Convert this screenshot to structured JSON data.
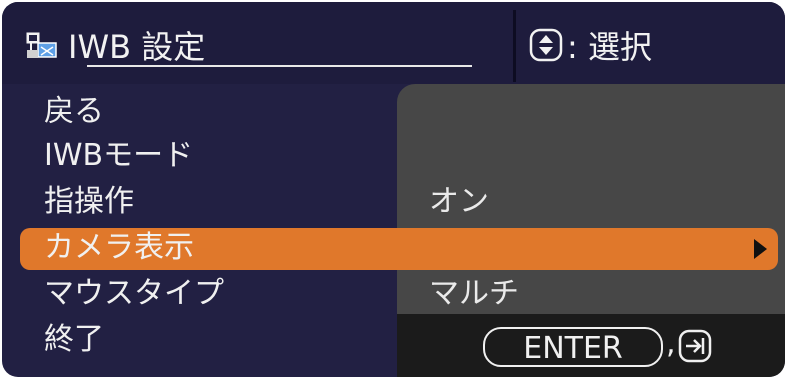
{
  "header": {
    "title": "IWB 設定",
    "hint": ": 選択",
    "title_icon": "iwb-settings-icon",
    "hint_icon": "up-down-navigation-icon"
  },
  "menu": {
    "items": [
      {
        "label": "戻る",
        "value": ""
      },
      {
        "label": "IWBモード",
        "value": ""
      },
      {
        "label": "指操作",
        "value": "オン"
      },
      {
        "label": "カメラ表示",
        "value": "",
        "selected": true
      },
      {
        "label": "マウスタイプ",
        "value": "マルチ"
      },
      {
        "label": "終了",
        "value": ""
      }
    ]
  },
  "footer": {
    "enter_label": "ENTER",
    "separator": ",",
    "exit_icon": "exit-arrow-icon"
  },
  "colors": {
    "background": "#222043",
    "panel": "#474747",
    "highlight": "#e0782b",
    "footer": "#1b1b1b"
  }
}
